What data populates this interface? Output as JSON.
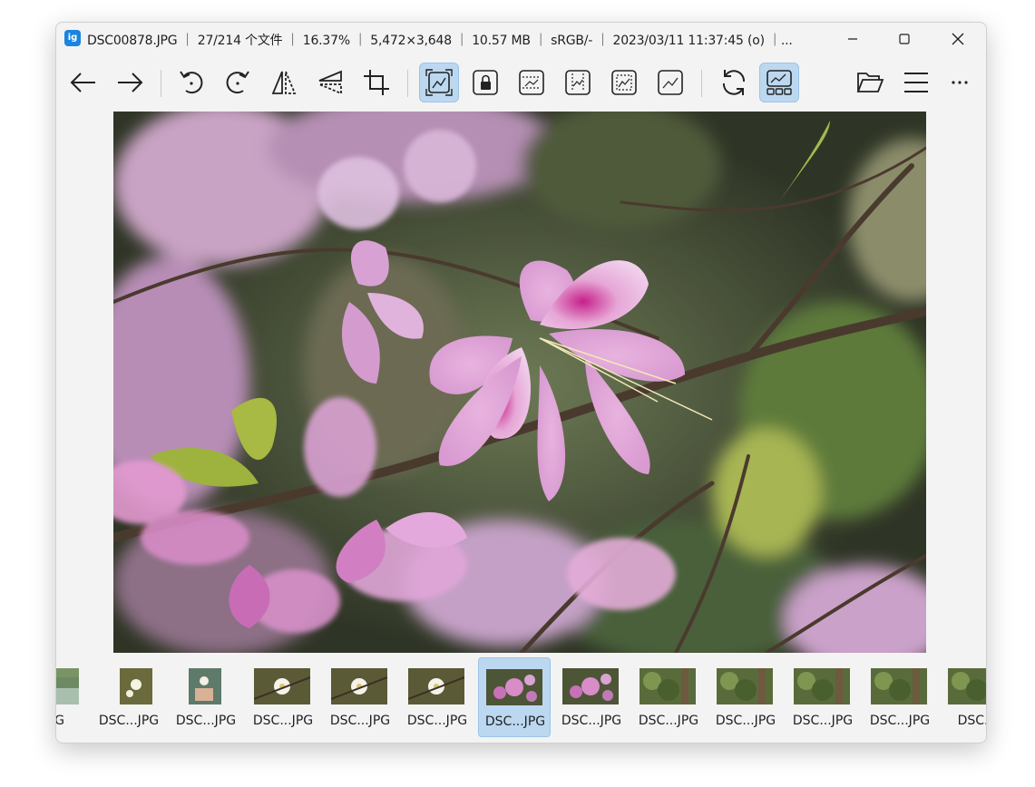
{
  "window": {
    "title": "DSC00878.JPG ｜ 27/214 个文件 ｜ 16.37% ｜ 5,472×3,648 ｜ 10.57 MB ｜ sRGB/- ｜ 2023/03/11 11:37:45 (o) ｜...",
    "app_icon_label": "ig"
  },
  "toolbar": {
    "buttons": [
      {
        "name": "back-arrow-icon",
        "active": false
      },
      {
        "name": "forward-arrow-icon",
        "active": false
      },
      {
        "name": "rotate-left-icon",
        "active": false
      },
      {
        "name": "rotate-right-icon",
        "active": false
      },
      {
        "name": "flip-horizontal-icon",
        "active": false
      },
      {
        "name": "flip-vertical-icon",
        "active": false
      },
      {
        "name": "crop-icon",
        "active": false
      },
      {
        "name": "fit-window-icon",
        "active": true
      },
      {
        "name": "lock-zoom-icon",
        "active": false
      },
      {
        "name": "fit-width-icon",
        "active": false
      },
      {
        "name": "fit-height-icon",
        "active": false
      },
      {
        "name": "auto-zoom-icon",
        "active": false
      },
      {
        "name": "actual-size-icon",
        "active": false
      },
      {
        "name": "refresh-icon",
        "active": false
      },
      {
        "name": "gallery-icon",
        "active": true
      },
      {
        "name": "open-folder-icon",
        "active": false
      },
      {
        "name": "menu-icon",
        "active": false
      },
      {
        "name": "more-icon",
        "active": false
      }
    ]
  },
  "viewer": {
    "image_subject": "pink bauhinia flowers on branches"
  },
  "filmstrip": {
    "items": [
      {
        "caption": ".JPG",
        "thumb": "landscape-water",
        "active": false
      },
      {
        "caption": "DSC...JPG",
        "thumb": "white-flower-portrait",
        "active": false
      },
      {
        "caption": "DSC...JPG",
        "thumb": "hand-flower-portrait",
        "active": false
      },
      {
        "caption": "DSC...JPG",
        "thumb": "white-flower",
        "active": false
      },
      {
        "caption": "DSC...JPG",
        "thumb": "white-flower",
        "active": false
      },
      {
        "caption": "DSC...JPG",
        "thumb": "white-flower",
        "active": false
      },
      {
        "caption": "DSC...JPG",
        "thumb": "pink-flower",
        "active": true
      },
      {
        "caption": "DSC...JPG",
        "thumb": "pink-flower",
        "active": false
      },
      {
        "caption": "DSC...JPG",
        "thumb": "forest",
        "active": false
      },
      {
        "caption": "DSC...JPG",
        "thumb": "forest",
        "active": false
      },
      {
        "caption": "DSC...JPG",
        "thumb": "forest",
        "active": false
      },
      {
        "caption": "DSC...JPG",
        "thumb": "forest",
        "active": false
      },
      {
        "caption": "DSC...",
        "thumb": "forest",
        "active": false
      }
    ]
  },
  "colors": {
    "accent_active": "#bcd8f0",
    "window_bg": "#f3f3f3",
    "app_icon": "#1a84e0"
  }
}
